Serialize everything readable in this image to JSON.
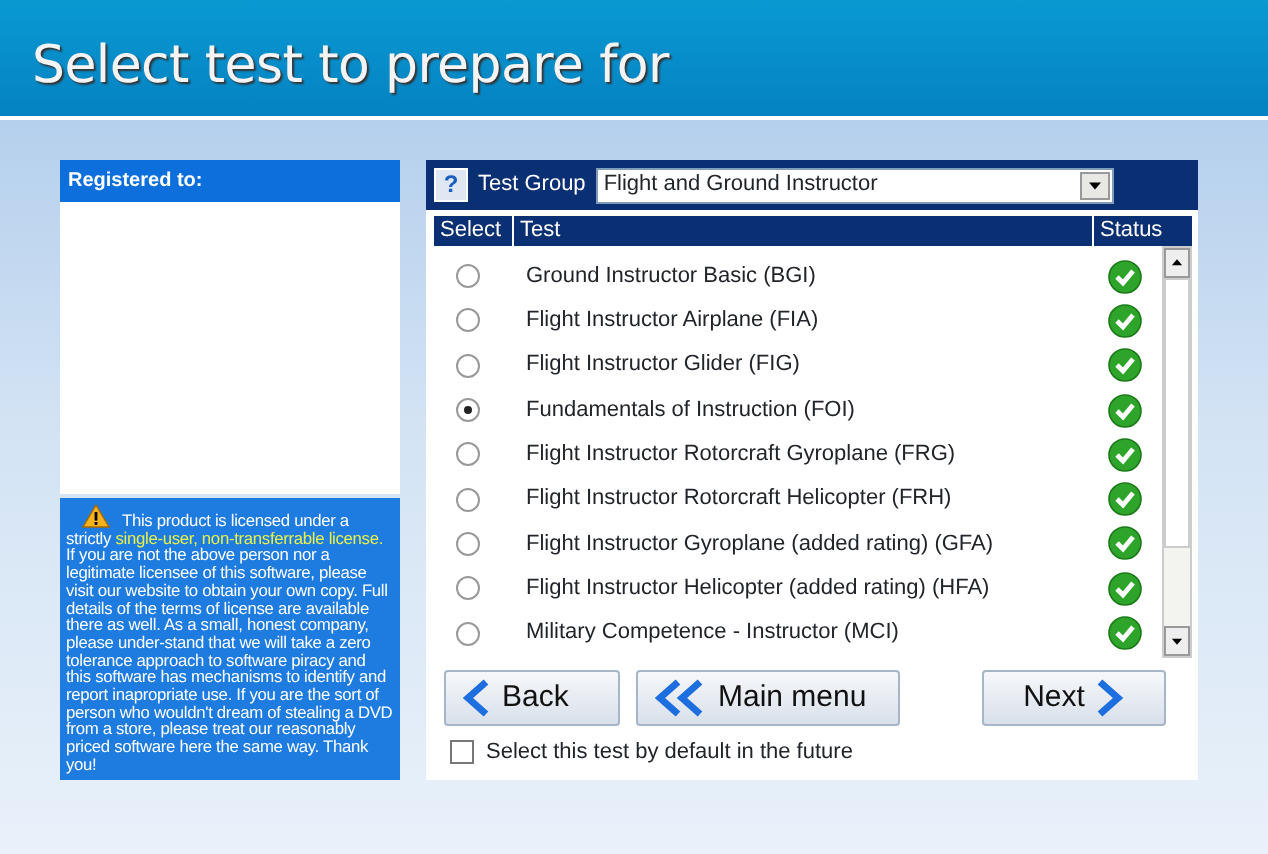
{
  "header": {
    "title": "Select test to prepare for"
  },
  "registration": {
    "heading": "Registered to:"
  },
  "license_notice": [
    {
      "text": "This product is licensed under a strictly ",
      "highlight": false
    },
    {
      "text": "single-user, non-transferrable license.",
      "highlight": true
    },
    {
      "text": "  If you are not the above person nor a legitimate licensee of this software, please visit our website to obtain your own copy.  Full details of the terms of license are available there as well. As a small, honest company, please under-stand that we will take a zero tolerance approach to software piracy and this software has mechanisms to identify and report inapropriate use.  If you are the sort of person who wouldn't dream of stealing a DVD from a store, please treat our reasonably priced software here the same way.  Thank you!",
      "highlight": false
    }
  ],
  "test_group": {
    "help": "?",
    "label": "Test Group",
    "value": "Flight and Ground Instructor"
  },
  "table": {
    "columns": [
      "Select",
      "Test",
      "Status"
    ],
    "rows": [
      {
        "test": "Ground Instructor Basic (BGI)",
        "selected": false,
        "available": true
      },
      {
        "test": "Flight Instructor Airplane (FIA)",
        "selected": false,
        "available": true
      },
      {
        "test": "Flight Instructor Glider (FIG)",
        "selected": false,
        "available": true
      },
      {
        "test": "Fundamentals of Instruction (FOI)",
        "selected": true,
        "available": true
      },
      {
        "test": "Flight Instructor Rotorcraft Gyroplane (FRG)",
        "selected": false,
        "available": true
      },
      {
        "test": "Flight Instructor Rotorcraft Helicopter (FRH)",
        "selected": false,
        "available": true
      },
      {
        "test": "Flight Instructor Gyroplane (added rating) (GFA)",
        "selected": false,
        "available": true
      },
      {
        "test": "Flight Instructor Helicopter (added rating) (HFA)",
        "selected": false,
        "available": true
      },
      {
        "test": "Military Competence - Instructor (MCI)",
        "selected": false,
        "available": true
      }
    ]
  },
  "buttons": [
    {
      "kind": "back",
      "label": "Back"
    },
    {
      "kind": "menu",
      "label": "Main menu"
    },
    {
      "kind": "next",
      "label": "Next"
    }
  ],
  "default_option": {
    "label": "Select this test by default in the future",
    "checked": false
  }
}
